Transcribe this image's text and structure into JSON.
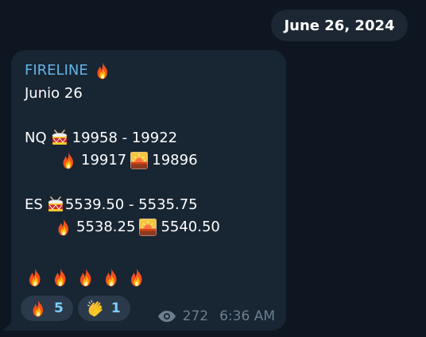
{
  "date_pill": "June 26, 2024",
  "message": {
    "sender": "FIRELINE",
    "sender_icon": "fire-icon",
    "line1": "Junio 26",
    "nq_label": "NQ",
    "nq_range": "19958 - 19922",
    "nq_target1": "19917",
    "nq_target2": "19896",
    "es_label": "ES",
    "es_range": "5539.50 - 5535.75",
    "es_target1": "5538.25",
    "es_target2": "5540.50",
    "fire_count": 5
  },
  "reactions": [
    {
      "icon": "fire-icon",
      "count": "5"
    },
    {
      "icon": "clapping-hands-icon",
      "count": "1"
    }
  ],
  "meta": {
    "views": "272",
    "time": "6:36 AM"
  },
  "colors": {
    "background": "#0e1621",
    "bubble": "#182533",
    "sender": "#63b3e6",
    "reaction_count": "#7ecbff",
    "meta_text": "#6d7f8f"
  }
}
